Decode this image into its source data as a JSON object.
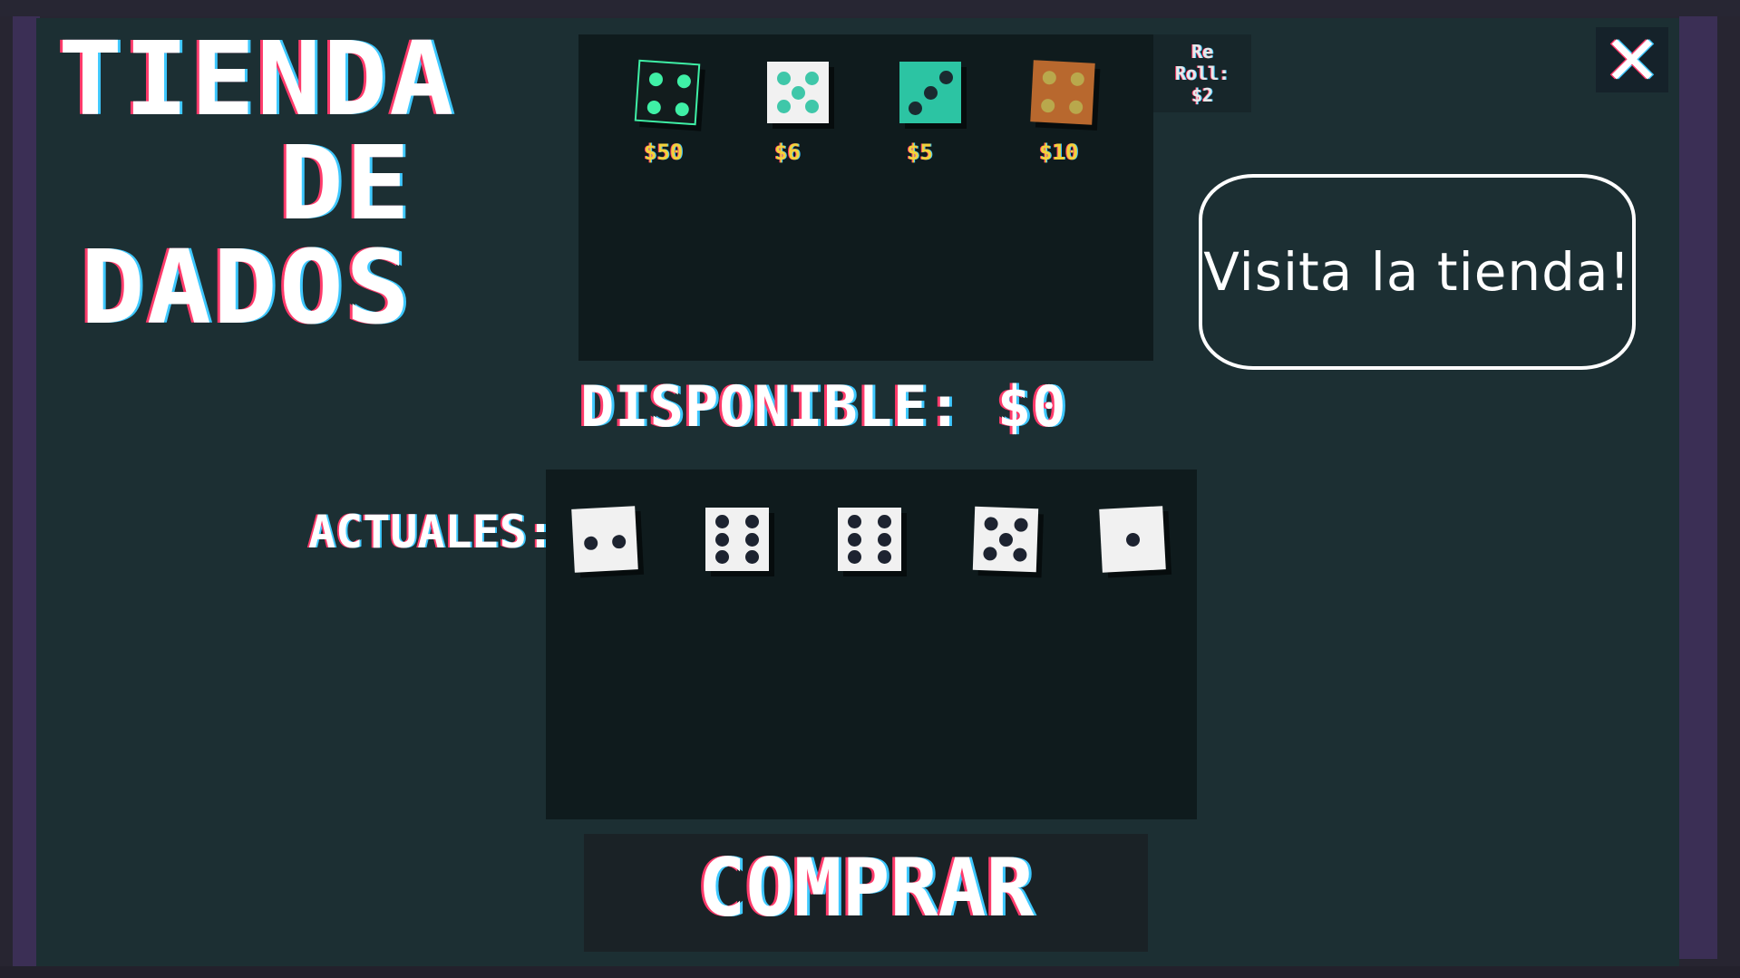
{
  "title": {
    "line1": "TIENDA",
    "line2": "DE",
    "line3": "DADOS"
  },
  "shop": {
    "reroll": {
      "line1": "Re",
      "line2": "Roll:",
      "line3": "$2"
    },
    "items": [
      {
        "price": "$50",
        "face": 4,
        "color": "#121c1d",
        "pip_color": "#3ff0a6"
      },
      {
        "price": "$6",
        "face": 5,
        "color": "#f1f1f1",
        "pip_color": "#3fc7a9"
      },
      {
        "price": "$5",
        "face": 3,
        "color": "#2cc4a3",
        "pip_color": "#1a2a30"
      },
      {
        "price": "$10",
        "face": 4,
        "color": "#b8682e",
        "pip_color": "#b9a84c"
      }
    ]
  },
  "close_icon": "✕",
  "speech": "Visita la tienda!",
  "disponible": "DISPONIBLE: $0",
  "owned": {
    "label": "ACTUALES:",
    "dice": [
      {
        "face": 2,
        "color": "#f1f1f1",
        "pip_color": "#1d2330"
      },
      {
        "face": 6,
        "color": "#f1f1f1",
        "pip_color": "#1d2330"
      },
      {
        "face": 6,
        "color": "#f1f1f1",
        "pip_color": "#1d2330"
      },
      {
        "face": 5,
        "color": "#f1f1f1",
        "pip_color": "#1d2330"
      },
      {
        "face": 1,
        "color": "#f1f1f1",
        "pip_color": "#1d2330"
      }
    ]
  },
  "buy_button": "COMPRAR"
}
